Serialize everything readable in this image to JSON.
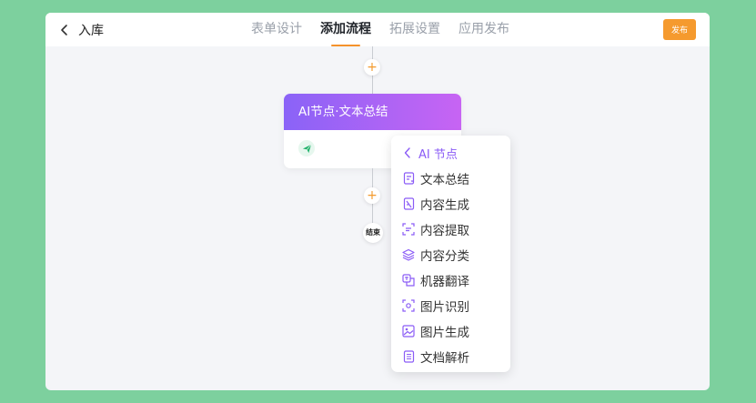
{
  "header": {
    "back_label": "入库",
    "tabs": [
      {
        "label": "表单设计"
      },
      {
        "label": "添加流程"
      },
      {
        "label": "拓展设置"
      },
      {
        "label": "应用发布"
      }
    ],
    "publish_label": "发布"
  },
  "flow": {
    "node_title": "AI节点·文本总结",
    "add_symbol": "+",
    "end_label": "结束"
  },
  "menu": {
    "title": "AI 节点",
    "items": [
      {
        "label": "文本总结",
        "icon": "summary-doc-icon"
      },
      {
        "label": "内容生成",
        "icon": "generate-doc-icon"
      },
      {
        "label": "内容提取",
        "icon": "extract-scan-icon"
      },
      {
        "label": "内容分类",
        "icon": "layers-icon"
      },
      {
        "label": "机器翻译",
        "icon": "translate-icon"
      },
      {
        "label": "图片识别",
        "icon": "image-scan-icon"
      },
      {
        "label": "图片生成",
        "icon": "image-generate-icon"
      },
      {
        "label": "文档解析",
        "icon": "document-parse-icon"
      }
    ]
  },
  "colors": {
    "accent_orange": "#f59a2e",
    "menu_purple": "#8b5cf6",
    "node_gradient_start": "#8a63f7",
    "node_gradient_end": "#c764f3",
    "background_green": "#7dd09e"
  }
}
